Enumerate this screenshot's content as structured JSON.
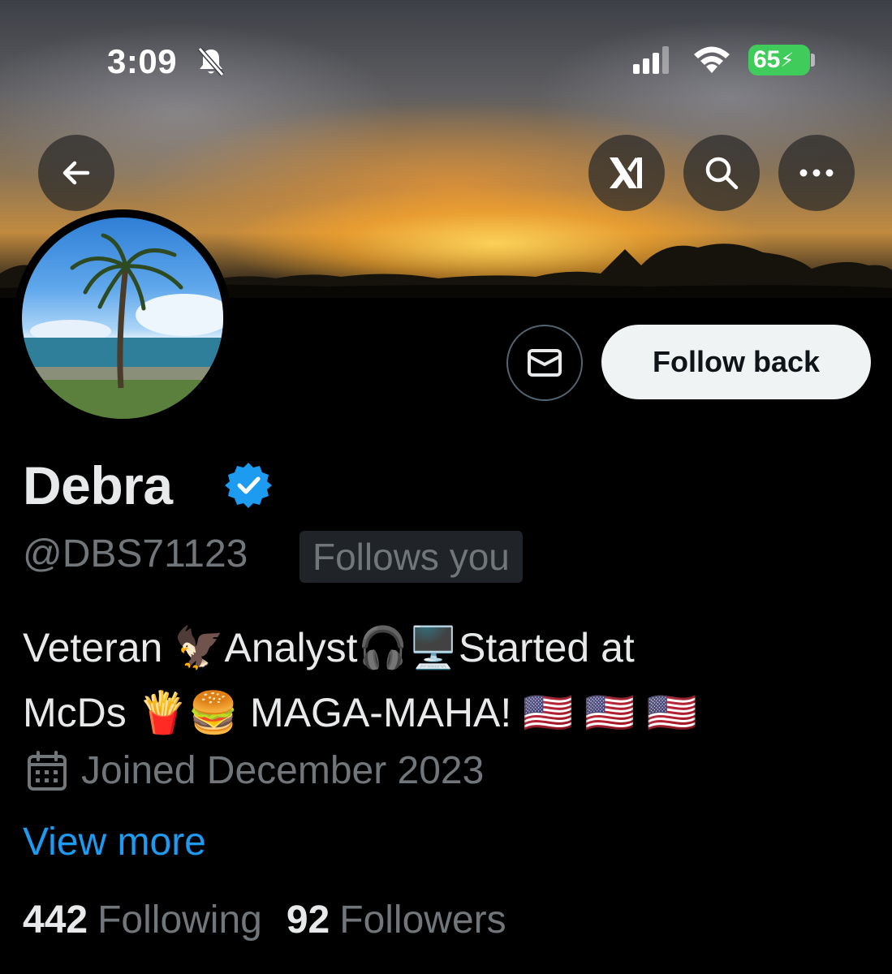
{
  "status_bar": {
    "time": "3:09",
    "battery": "65",
    "icons": [
      "bell-slash-icon",
      "signal-icon",
      "wifi-icon",
      "battery-charging-icon"
    ]
  },
  "header": {
    "back_icon": "arrow-left-icon",
    "grok_icon": "grok-icon",
    "search_icon": "search-icon",
    "more_icon": "more-horizontal-icon"
  },
  "actions": {
    "message_icon": "envelope-icon",
    "follow_label": "Follow back"
  },
  "profile": {
    "name": "Debra",
    "verified_icon": "verified-badge-icon",
    "handle": "@DBS71123",
    "follows_you": "Follows you",
    "bio_line1": "Veteran 🦅Analyst🎧🖥️Started at",
    "bio_line2": "McDs 🍟🍔 MAGA-MAHA! 🇺🇸 🇺🇸 🇺🇸",
    "joined": "Joined December 2023",
    "view_more": "View more"
  },
  "stats": {
    "following_count": "442",
    "following_label": "Following",
    "followers_count": "92",
    "followers_label": "Followers"
  },
  "colors": {
    "accent": "#1d9bf0",
    "muted_text": "#71767b",
    "battery": "#3fcc5a"
  }
}
